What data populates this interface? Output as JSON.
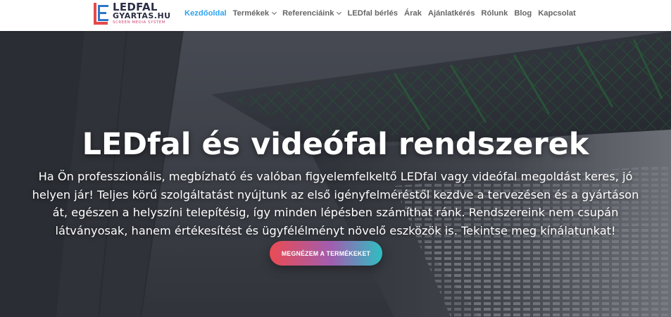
{
  "logo": {
    "line1": "LEDFAL",
    "line2": "GYARTAS.HU",
    "line3": "SCREEN MEDIA SYSTEM",
    "colors": {
      "dark": "#2a2c44",
      "pink": "#d24a76",
      "blue": "#2b78c9",
      "red": "#e54a4a"
    }
  },
  "nav": {
    "items": [
      {
        "label": "Kezdőoldal",
        "active": true,
        "dropdown": false
      },
      {
        "label": "Termékek",
        "active": false,
        "dropdown": true
      },
      {
        "label": "Referenciáink",
        "active": false,
        "dropdown": true
      },
      {
        "label": "LEDfal bérlés",
        "active": false,
        "dropdown": false
      },
      {
        "label": "Árak",
        "active": false,
        "dropdown": false
      },
      {
        "label": "Ajánlatkérés",
        "active": false,
        "dropdown": false
      },
      {
        "label": "Rólunk",
        "active": false,
        "dropdown": false
      },
      {
        "label": "Blog",
        "active": false,
        "dropdown": false
      },
      {
        "label": "Kapcsolat",
        "active": false,
        "dropdown": false
      }
    ],
    "active_color": "#2ea3f2",
    "text_color": "#666666",
    "dropdown_icon": "chevron-down-icon"
  },
  "hero": {
    "title": "LEDfal és videófal rendszerek",
    "text": "Ha Ön professzionális, megbízható és valóban figyelemfelkeltő LEDfal vagy videófal megoldást keres, jó helyen jár! Teljes körű szolgáltatást nyújtunk az első igényfelméréstől kezdve a tervezésen és a gyártáson át, egészen a helyszíni telepítésig, így minden lépésben számíthat ránk. Rendszereink nem csupán látványosak, hanem értékesítést és ügyfélélményt növelő eszközök is. Tekintse meg kínálatunkat!",
    "cta_label": "MEGNÉZEM A TERMÉKEKET",
    "cta_gradient": [
      "#ea4b53",
      "#a05eb0",
      "#2ebfc2"
    ]
  }
}
